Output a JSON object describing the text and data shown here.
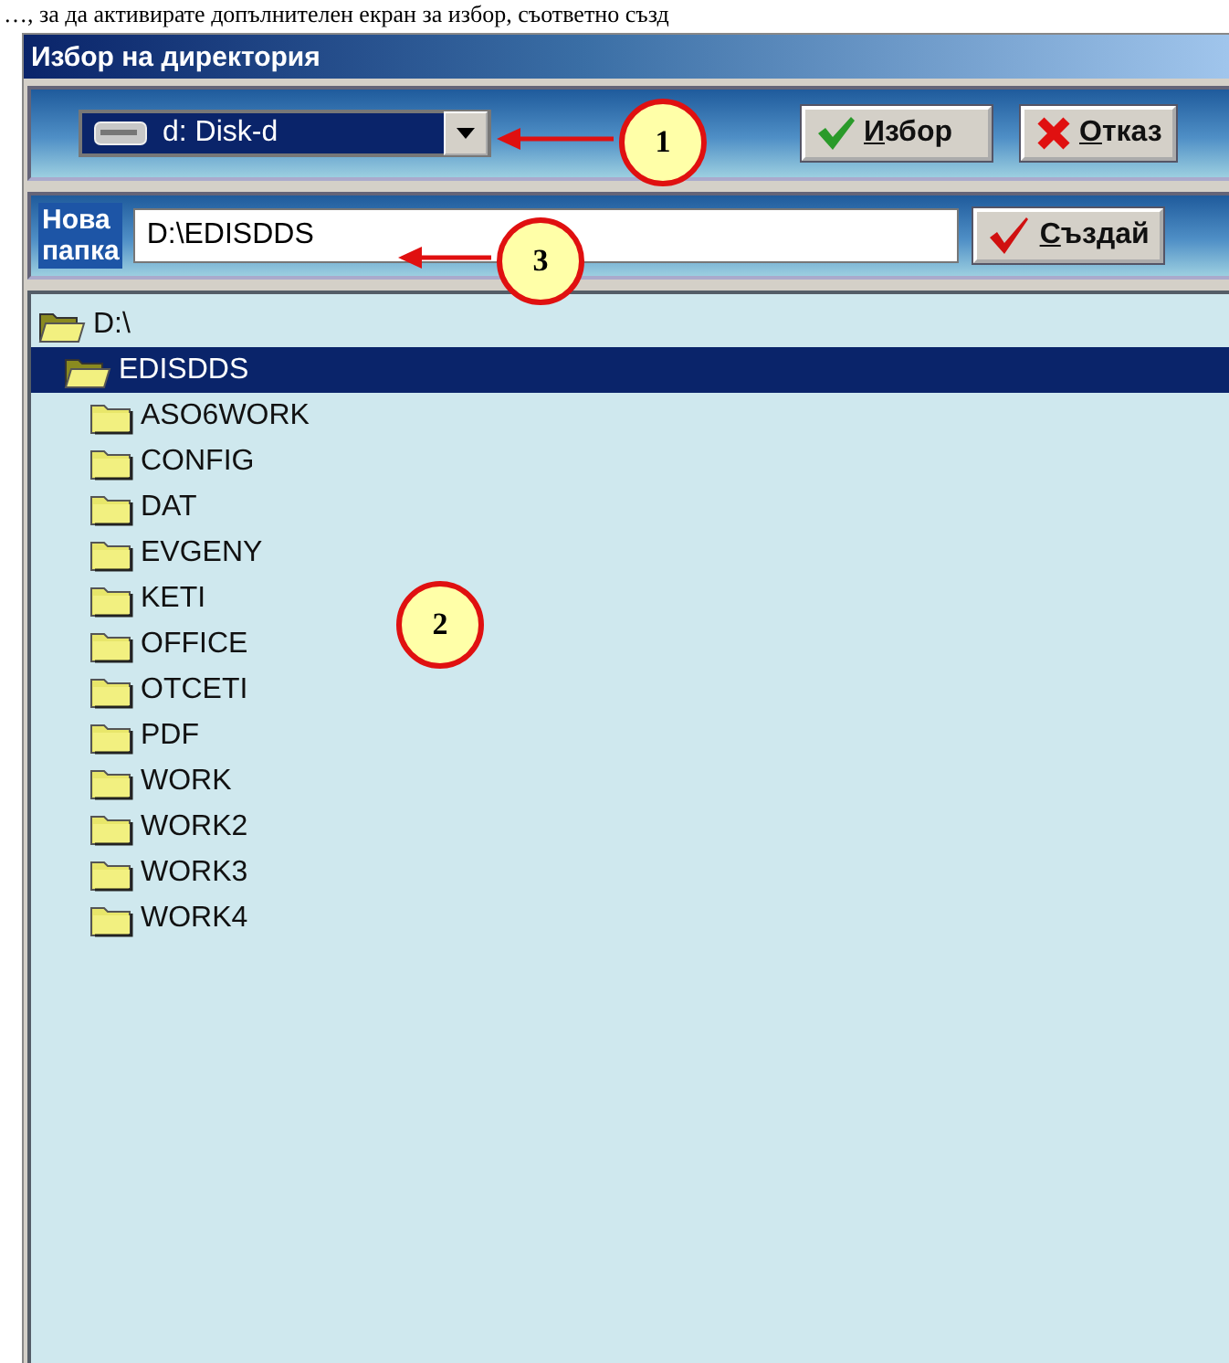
{
  "caption": "…, за да активирате допълнителен екран за избор, съответно създ",
  "window": {
    "title": "Избор на директория"
  },
  "drive_select": {
    "value": "d: Disk-d"
  },
  "buttons": [
    {
      "label": "Избор",
      "kind": "ok"
    },
    {
      "label": "Отказ",
      "kind": "cancel"
    }
  ],
  "new_folder": {
    "label": "Нова папка",
    "value": "D:\\EDISDDS",
    "button": "Създай"
  },
  "tree": [
    {
      "label": "D:\\",
      "expanded": true,
      "selected": false,
      "children": [
        {
          "label": "EDISDDS",
          "expanded": true,
          "selected": true,
          "children": [
            {
              "label": "ASO6WORK",
              "expanded": false,
              "selected": false
            },
            {
              "label": "CONFIG",
              "expanded": false,
              "selected": false
            },
            {
              "label": "DAT",
              "expanded": false,
              "selected": false
            },
            {
              "label": "EVGENY",
              "expanded": false,
              "selected": false
            },
            {
              "label": "KETI",
              "expanded": false,
              "selected": false
            },
            {
              "label": "OFFICE",
              "expanded": false,
              "selected": false
            },
            {
              "label": "OTCETI",
              "expanded": false,
              "selected": false
            },
            {
              "label": "PDF",
              "expanded": false,
              "selected": false
            },
            {
              "label": "WORK",
              "expanded": false,
              "selected": false
            },
            {
              "label": "WORK2",
              "expanded": false,
              "selected": false
            },
            {
              "label": "WORK3",
              "expanded": false,
              "selected": false
            },
            {
              "label": "WORK4",
              "expanded": false,
              "selected": false
            }
          ]
        }
      ]
    }
  ],
  "callouts": [
    {
      "label": "1",
      "arrow": true
    },
    {
      "label": "2",
      "arrow": false
    },
    {
      "label": "3",
      "arrow": true
    }
  ]
}
